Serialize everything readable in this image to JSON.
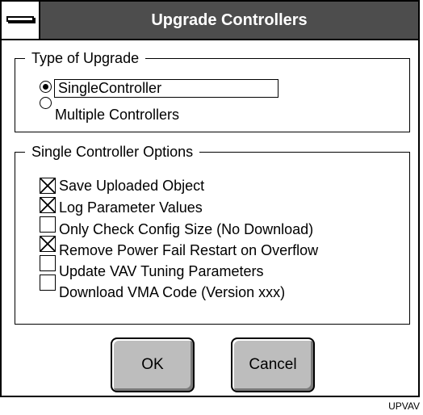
{
  "window": {
    "title": "Upgrade Controllers"
  },
  "type_group": {
    "legend": "Type of Upgrade",
    "options": [
      {
        "label": "SingleController",
        "selected": true
      },
      {
        "label": "Multiple Controllers",
        "selected": false
      }
    ]
  },
  "options_group": {
    "legend": "Single Controller Options",
    "items": [
      {
        "label": "Save Uploaded Object",
        "checked": true
      },
      {
        "label": "Log Parameter Values",
        "checked": true
      },
      {
        "label": "Only Check Config Size (No Download)",
        "checked": false
      },
      {
        "label": "Remove Power Fail Restart on Overflow",
        "checked": true
      },
      {
        "label": "Update VAV Tuning Parameters",
        "checked": false
      },
      {
        "label": "Download VMA Code (Version xxx)",
        "checked": false
      }
    ]
  },
  "buttons": {
    "ok": "OK",
    "cancel": "Cancel"
  },
  "footer": {
    "code": "UPVAV"
  }
}
